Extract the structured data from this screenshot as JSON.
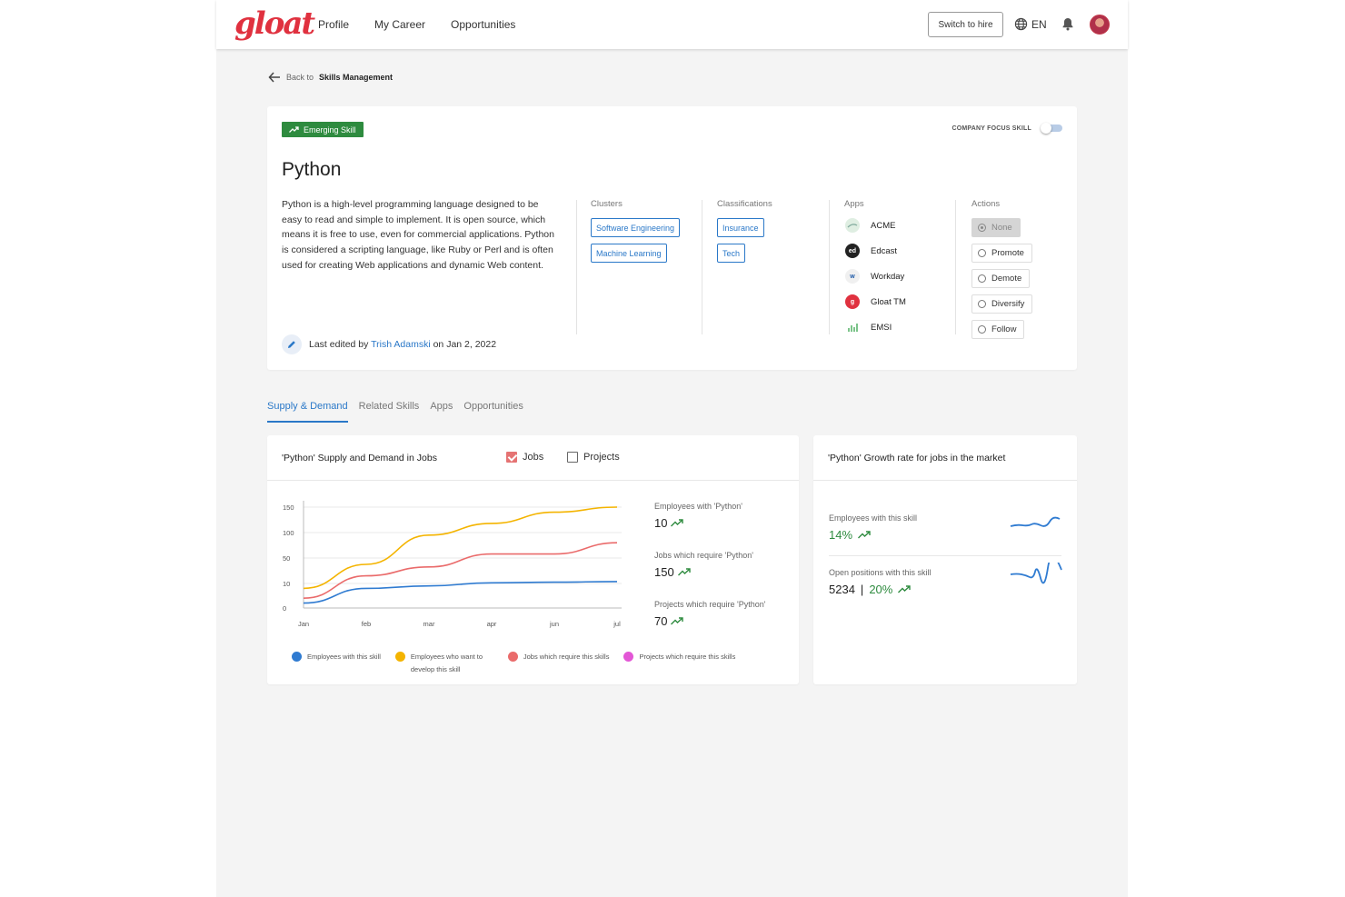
{
  "brand": {
    "logo_text": "gloat"
  },
  "nav": {
    "items": [
      "Profile",
      "My Career",
      "Opportunities"
    ]
  },
  "header": {
    "switch_label": "Switch to hire",
    "language": "EN"
  },
  "back": {
    "prefix": "Back to",
    "target": "Skills Management"
  },
  "skill": {
    "badge": "Emerging Skill",
    "focus_label": "COMPANY FOCUS SKILL",
    "name": "Python",
    "description": "Python is a high-level programming language designed to be easy to read and simple to implement. It is open source, which means it is free to use, even for commercial applications. Python is considered a scripting language, like Ruby or Perl and is often used for creating Web applications and dynamic Web content.",
    "edited_prefix": "Last edited by",
    "edited_by": "Trish Adamski",
    "edited_on": "on Jan 2, 2022",
    "clusters_label": "Clusters",
    "clusters": [
      "Software Engineering",
      "Machine Learning"
    ],
    "classifications_label": "Classifications",
    "classifications": [
      "Insurance",
      "Tech"
    ],
    "apps_label": "Apps",
    "apps": [
      {
        "name": "ACME",
        "color": "#dfeee2"
      },
      {
        "name": "Edcast",
        "color": "#222222"
      },
      {
        "name": "Workday",
        "color": "#f0f0f0"
      },
      {
        "name": "Gloat TM",
        "color": "#e0313f"
      },
      {
        "name": "EMSI",
        "color": "#ffffff"
      }
    ],
    "actions_label": "Actions",
    "actions": [
      "None",
      "Promote",
      "Demote",
      "Diversify",
      "Follow"
    ],
    "selected_action": "None"
  },
  "tabs": [
    "Supply & Demand",
    "Related Skills",
    "Apps",
    "Opportunities"
  ],
  "supply": {
    "title": "'Python' Supply and Demand in Jobs",
    "jobs_label": "Jobs",
    "projects_label": "Projects",
    "stats": [
      {
        "label": "Employees with 'Python'",
        "value": "10"
      },
      {
        "label": "Jobs which require 'Python'",
        "value": "150"
      },
      {
        "label": "Projects which require 'Python'",
        "value": "70"
      }
    ]
  },
  "growth": {
    "title": "'Python' Growth rate for jobs in the market",
    "row1_label": "Employees with this skill",
    "row1_value": "14%",
    "row2_label": "Open positions with this skill",
    "row2_count": "5234",
    "row2_sep": "|",
    "row2_pct": "20%"
  },
  "colors": {
    "accent": "#2a78c8",
    "brand": "#e0313f",
    "green": "#2e8b3f"
  },
  "chart_data": {
    "type": "line",
    "categories": [
      "Jan",
      "feb",
      "mar",
      "apr",
      "jun",
      "jul"
    ],
    "y_ticks": [
      "0",
      "10",
      "50",
      "100",
      "150"
    ],
    "series": [
      {
        "name": "Employees with this skill",
        "color": "#2f7bd1",
        "values": [
          2,
          8,
          9,
          11,
          12,
          13
        ]
      },
      {
        "name": "Employees who want to develop this skill",
        "color": "#f4b400",
        "values": [
          8,
          40,
          95,
          118,
          140,
          150
        ]
      },
      {
        "name": "Jobs which require this skills",
        "color": "#ea6b6b",
        "values": [
          4,
          22,
          36,
          58,
          58,
          80
        ]
      },
      {
        "name": "Projects which require this skills",
        "color": "#e357d6",
        "values": []
      }
    ],
    "grid": true,
    "legend_position": "bottom"
  }
}
